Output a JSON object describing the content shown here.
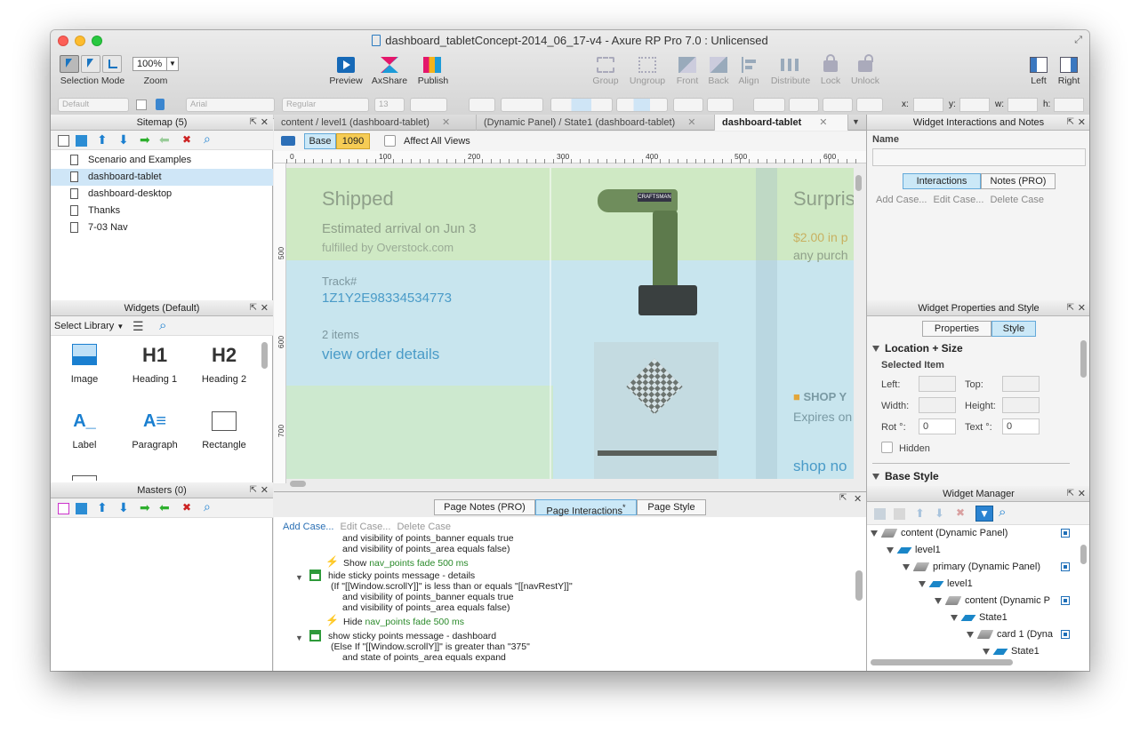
{
  "window": {
    "title": "dashboard_tabletConcept-2014_06_17-v4 - Axure RP Pro 7.0 : Unlicensed"
  },
  "toolbar": {
    "selection_mode": "Selection Mode",
    "zoom_value": "100%",
    "zoom_label": "Zoom",
    "preview": "Preview",
    "axshare": "AxShare",
    "publish": "Publish",
    "group": "Group",
    "ungroup": "Ungroup",
    "front": "Front",
    "back": "Back",
    "align": "Align",
    "distribute": "Distribute",
    "lock": "Lock",
    "unlock": "Unlock",
    "left": "Left",
    "right": "Right"
  },
  "format_bar": {
    "style": "Default",
    "font": "Arial",
    "weight": "Regular",
    "size": "13",
    "x_label": "x:",
    "y_label": "y:",
    "w_label": "w:",
    "h_label": "h:"
  },
  "sitemap": {
    "title": "Sitemap (5)",
    "pages": [
      "Scenario and Examples",
      "dashboard-tablet",
      "dashboard-desktop",
      "Thanks",
      "7-03 Nav"
    ]
  },
  "widgets": {
    "title": "Widgets (Default)",
    "select_library": "Select Library",
    "items": [
      "Image",
      "Heading 1",
      "Heading 2",
      "Label",
      "Paragraph",
      "Rectangle"
    ],
    "h1_glyph": "H1",
    "h2_glyph": "H2"
  },
  "masters": {
    "title": "Masters (0)"
  },
  "editor": {
    "tabs": [
      "content / level1 (dashboard-tablet)",
      "(Dynamic Panel) / State1 (dashboard-tablet)",
      "dashboard-tablet"
    ],
    "base": "Base",
    "breakpoint": "1090",
    "affect_all_views": "Affect All Views",
    "ruler_h": [
      "0",
      "100",
      "200",
      "300",
      "400",
      "500",
      "600"
    ],
    "ruler_v": [
      "500",
      "600",
      "700"
    ]
  },
  "canvas": {
    "shipped": "Shipped",
    "arrival": "Estimated arrival on Jun 3",
    "fulfilled": "fulfilled by Overstock.com",
    "track_label": "Track#",
    "track_number": "1Z1Y2E98334534773",
    "items": "2 items",
    "view_order": "view order details",
    "surprise": "Surpris",
    "price": "$2.00 in p",
    "any_purchase": "any purch",
    "shop": "SHOP Y",
    "expires": "Expires on",
    "shop_now": "shop no"
  },
  "page_panel": {
    "tabs": [
      "Page Notes (PRO)",
      "Page Interactions",
      "Page Style"
    ],
    "asterisk": "*",
    "add_case": "Add Case...",
    "edit_case": "Edit Case...",
    "delete_case": "Delete Case",
    "lines": [
      "and visibility of points_banner equals true",
      "and visibility of points_area equals false)",
      "Show",
      "nav_points fade 500 ms",
      "hide sticky points message - details",
      "(If \"[[Window.scrollY]]\" is less than or equals \"[[navRestY]]\"",
      "and visibility of points_banner equals true",
      "and visibility of points_area equals false)",
      "Hide",
      "nav_points fade 500 ms",
      "show sticky points message - dashboard",
      "(Else If \"[[Window.scrollY]]\" is greater than \"375\"",
      "and state of points_area equals expand"
    ]
  },
  "interactions_panel": {
    "title": "Widget Interactions and Notes",
    "name_label": "Name",
    "tab_interactions": "Interactions",
    "tab_notes": "Notes (PRO)",
    "add_case": "Add Case...",
    "edit_case": "Edit Case...",
    "delete_case": "Delete Case"
  },
  "properties_panel": {
    "title": "Widget Properties and Style",
    "tab_properties": "Properties",
    "tab_style": "Style",
    "location_size": "Location + Size",
    "selected_item": "Selected Item",
    "left": "Left:",
    "top": "Top:",
    "width": "Width:",
    "height": "Height:",
    "rot": "Rot °:",
    "rot_value": "0",
    "text": "Text °:",
    "text_value": "0",
    "hidden": "Hidden",
    "base_style": "Base Style"
  },
  "widget_manager": {
    "title": "Widget Manager",
    "tree": [
      "content (Dynamic Panel)",
      "level1",
      "primary (Dynamic Panel)",
      "level1",
      "content (Dynamic P",
      "State1",
      "card 1 (Dyna",
      "State1"
    ]
  }
}
